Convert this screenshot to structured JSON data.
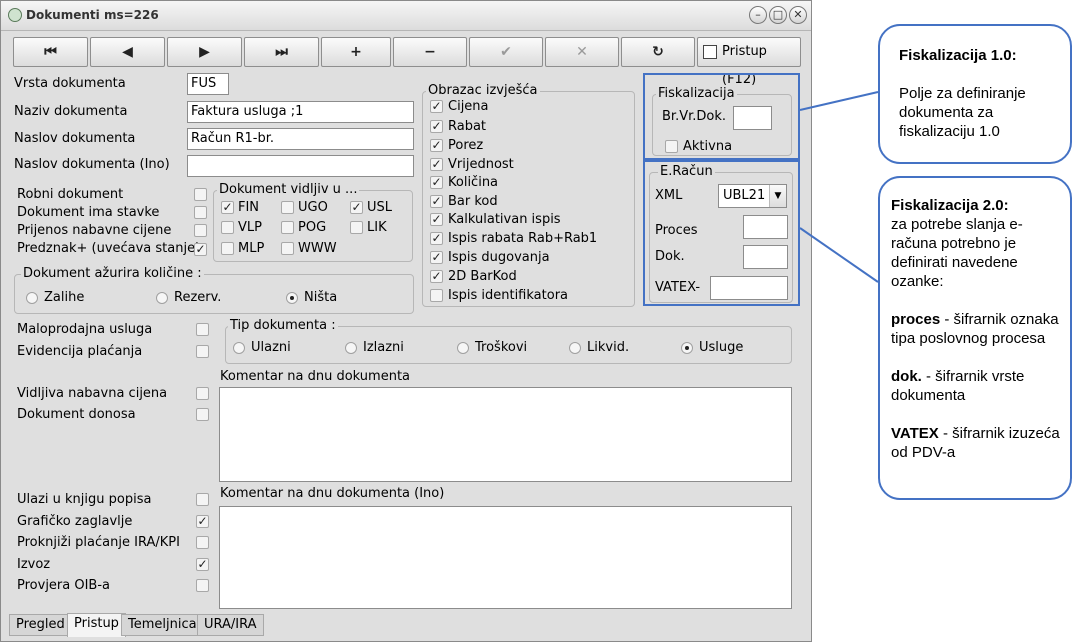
{
  "window": {
    "title": "Dokumenti ms=226"
  },
  "toolbar": {
    "first": "⏮",
    "prev": "◀",
    "next": "▶",
    "last": "⏭",
    "add": "+",
    "remove": "−",
    "confirm": "✔",
    "cancel": "✕",
    "refresh": "↻",
    "pristup": "Pristup (F12)"
  },
  "form": {
    "vrsta_label": "Vrsta dokumenta",
    "vrsta_value": "FUS",
    "naziv_label": "Naziv dokumenta",
    "naziv_value": "Faktura usluga ;1",
    "naslov_label": "Naslov dokumenta",
    "naslov_value": "Račun R1-br.",
    "naslov_ino_label": "Naslov dokumenta (Ino)",
    "naslov_ino_value": ""
  },
  "flags_left": [
    {
      "label": "Robni dokument",
      "checked": false
    },
    {
      "label": "Dokument ima stavke",
      "checked": false
    },
    {
      "label": "Prijenos nabavne cijene",
      "checked": false
    },
    {
      "label": "Predznak+ (uvećava stanje)",
      "checked": true
    }
  ],
  "vidljiv": {
    "title": "Dokument vidljiv u ...",
    "items": [
      {
        "label": "FIN",
        "checked": true
      },
      {
        "label": "UGO",
        "checked": false
      },
      {
        "label": "USL",
        "checked": true
      },
      {
        "label": "VLP",
        "checked": false
      },
      {
        "label": "POG",
        "checked": false
      },
      {
        "label": "LIK",
        "checked": false
      },
      {
        "label": "MLP",
        "checked": false
      },
      {
        "label": "WWW",
        "checked": false
      }
    ]
  },
  "kolicine": {
    "title": "Dokument ažurira količine :",
    "options": [
      {
        "label": "Zalihe",
        "selected": false
      },
      {
        "label": "Rezerv.",
        "selected": false
      },
      {
        "label": "Ništa",
        "selected": true
      }
    ]
  },
  "obrazac": {
    "title": "Obrazac izvješća",
    "items": [
      {
        "label": "Cijena",
        "checked": true
      },
      {
        "label": "Rabat",
        "checked": true
      },
      {
        "label": "Porez",
        "checked": true
      },
      {
        "label": "Vrijednost",
        "checked": true
      },
      {
        "label": "Količina",
        "checked": true
      },
      {
        "label": "Bar kod",
        "checked": true
      },
      {
        "label": "Kalkulativan ispis",
        "checked": true
      },
      {
        "label": "Ispis rabata Rab+Rab1",
        "checked": true
      },
      {
        "label": "Ispis dugovanja",
        "checked": true
      },
      {
        "label": "2D BarKod",
        "checked": true
      },
      {
        "label": "Ispis identifikatora",
        "checked": false
      }
    ]
  },
  "fiskalizacija": {
    "title": "Fiskalizacija",
    "brvr_label": "Br.Vr.Dok.",
    "brvr_value": "",
    "aktivna_label": "Aktivna",
    "aktivna_checked": false
  },
  "eracun": {
    "title": "E.Račun",
    "xml_label": "XML",
    "xml_value": "UBL21",
    "proces_label": "Proces",
    "dok_label": "Dok.",
    "vatex_label": "VATEX-"
  },
  "flags_mid": [
    {
      "label": "Maloprodajna usluga",
      "checked": false
    },
    {
      "label": "Evidencija plaćanja",
      "checked": false
    }
  ],
  "tip": {
    "title": "Tip dokumenta :",
    "options": [
      {
        "label": "Ulazni",
        "selected": false
      },
      {
        "label": "Izlazni",
        "selected": false
      },
      {
        "label": "Troškovi",
        "selected": false
      },
      {
        "label": "Likvid.",
        "selected": false
      },
      {
        "label": "Usluge",
        "selected": true
      }
    ]
  },
  "flags_mid2": [
    {
      "label": "Vidljiva nabavna cijena",
      "checked": false
    },
    {
      "label": "Dokument donosa",
      "checked": false
    }
  ],
  "komentar": {
    "label": "Komentar na dnu dokumenta",
    "label_ino": "Komentar na dnu dokumenta (Ino)"
  },
  "flags_bottom": [
    {
      "label": "Ulazi u knjigu popisa",
      "checked": false
    },
    {
      "label": "Grafičko zaglavlje",
      "checked": true
    },
    {
      "label": "Proknjiži plaćanje IRA/KPI",
      "checked": false
    },
    {
      "label": "Izvoz",
      "checked": true
    },
    {
      "label": "Provjera OIB-a",
      "checked": false
    }
  ],
  "tabs": [
    "Pregled",
    "Pristup",
    "Temeljnica",
    "URA/IRA"
  ],
  "callout1": {
    "title": "Fiskalizacija 1.0:",
    "body": "Polje za definiranje dokumenta za fiskalizaciju 1.0"
  },
  "callout2": {
    "title": "Fiskalizacija 2.0:",
    "intro": "za potrebe slanja e-računa potrebno je definirati navedene ozanke:",
    "p1_bold": "proces",
    "p1_text": " - šifrarnik oznaka tipa poslovnog procesa",
    "p2_bold": "dok.",
    "p2_text": " - šifrarnik vrste dokumenta",
    "p3_bold": "VATEX",
    "p3_text": " - šifrarnik izuzeća od PDV-a"
  },
  "colors": {
    "accent": "#4472c4",
    "window_bg": "#dfdfdf"
  }
}
